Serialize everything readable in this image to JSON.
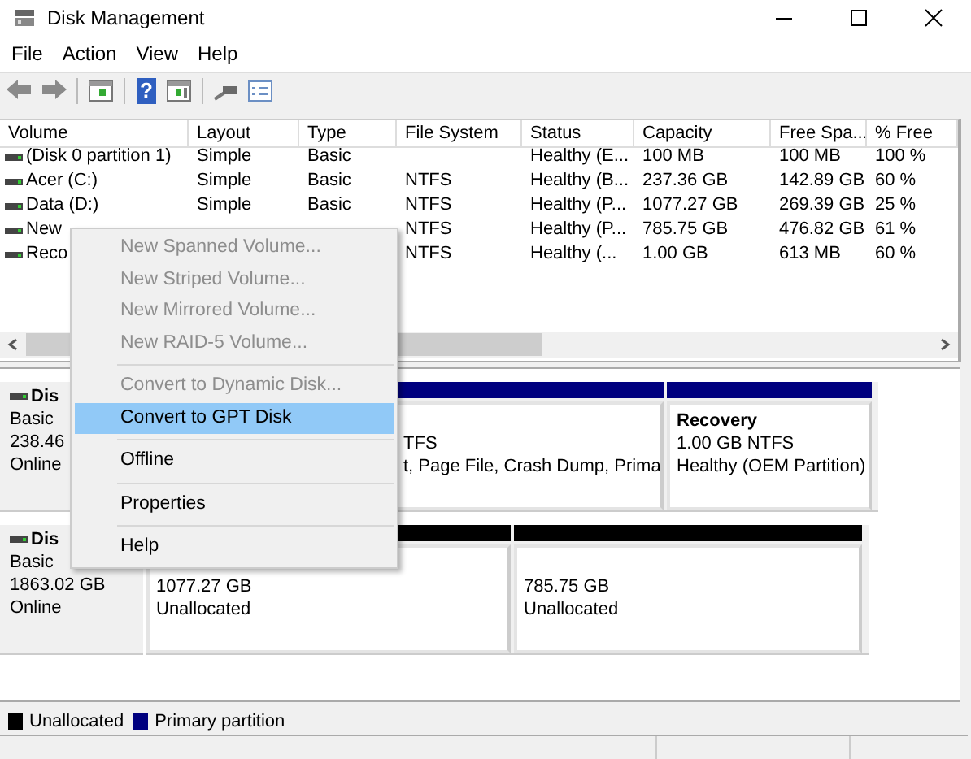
{
  "window": {
    "title": "Disk Management"
  },
  "menu_bar": [
    "File",
    "Action",
    "View",
    "Help"
  ],
  "toolbar": {
    "help_glyph": "?"
  },
  "volume_table": {
    "columns": [
      "Volume",
      "Layout",
      "Type",
      "File System",
      "Status",
      "Capacity",
      "Free Spa...",
      "% Free"
    ],
    "rows": [
      {
        "volume": "(Disk 0 partition 1)",
        "layout": "Simple",
        "type": "Basic",
        "status": "Healthy (E...",
        "capacity": "100 MB",
        "free_space": "100 MB",
        "percent_free": "100 %"
      },
      {
        "volume": "Acer (C:)",
        "layout": "Simple",
        "type": "Basic",
        "file_system": "NTFS",
        "status": "Healthy (B...",
        "capacity": "237.36 GB",
        "free_space": "142.89 GB",
        "percent_free": "60 %"
      },
      {
        "volume": "Data (D:)",
        "layout": "Simple",
        "type": "Basic",
        "file_system": "NTFS",
        "status": "Healthy (P...",
        "capacity": "1077.27 GB",
        "free_space": "269.39 GB",
        "percent_free": "25 %"
      },
      {
        "volume": "New",
        "file_system": "NTFS",
        "status": "Healthy (P...",
        "capacity": "785.75 GB",
        "free_space": "476.82 GB",
        "percent_free": "61 %"
      },
      {
        "volume": "Reco",
        "file_system": "NTFS",
        "status": "Healthy (...",
        "capacity": "1.00 GB",
        "free_space": "613 MB",
        "percent_free": "60 %"
      }
    ]
  },
  "disks": [
    {
      "name": "Dis",
      "type": "Basic",
      "size": "238.46",
      "state": "Online",
      "partitions": [
        {
          "kind": "primary",
          "lines": [
            "TFS",
            "t, Page File, Crash Dump, Prima"
          ]
        },
        {
          "kind": "primary",
          "title": "Recovery",
          "lines": [
            "1.00 GB NTFS",
            "Healthy (OEM Partition)"
          ]
        }
      ]
    },
    {
      "name": "Dis",
      "type": "Basic",
      "size": "1863.02 GB",
      "state": "Online",
      "partitions": [
        {
          "kind": "unallocated",
          "lines": [
            "1077.27 GB",
            "Unallocated"
          ]
        },
        {
          "kind": "unallocated",
          "lines": [
            "785.75 GB",
            "Unallocated"
          ]
        }
      ]
    }
  ],
  "legend": [
    {
      "label": "Unallocated",
      "color": "#000000"
    },
    {
      "label": "Primary partition",
      "color": "#00007f"
    }
  ],
  "context_menu": [
    {
      "kind": "item",
      "label": "New Spanned Volume...",
      "disabled": true,
      "selected": false
    },
    {
      "kind": "item",
      "label": "New Striped Volume...",
      "disabled": true,
      "selected": false
    },
    {
      "kind": "item",
      "label": "New Mirrored Volume...",
      "disabled": true,
      "selected": false
    },
    {
      "kind": "item",
      "label": "New RAID-5 Volume...",
      "disabled": true,
      "selected": false
    },
    {
      "kind": "separator"
    },
    {
      "kind": "item",
      "label": "Convert to Dynamic Disk...",
      "disabled": true,
      "selected": false
    },
    {
      "kind": "item",
      "label": "Convert to GPT Disk",
      "disabled": false,
      "selected": true
    },
    {
      "kind": "separator"
    },
    {
      "kind": "item",
      "label": "Offline",
      "disabled": false,
      "selected": false
    },
    {
      "kind": "separator"
    },
    {
      "kind": "item",
      "label": "Properties",
      "disabled": false,
      "selected": false
    },
    {
      "kind": "separator"
    },
    {
      "kind": "item",
      "label": "Help",
      "disabled": false,
      "selected": false
    }
  ]
}
